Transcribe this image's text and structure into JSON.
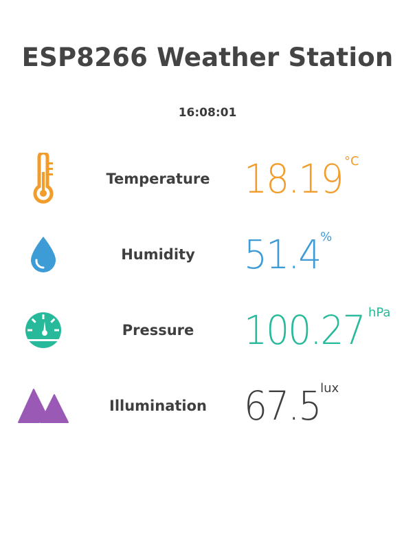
{
  "header": {
    "title": "ESP8266 Weather Station",
    "time": "16:08:01"
  },
  "readings": [
    {
      "label": "Temperature",
      "value": "18.19",
      "unit": "°C",
      "icon": "thermometer-icon",
      "color": "#f29c2b"
    },
    {
      "label": "Humidity",
      "value": "51.4",
      "unit": "%",
      "icon": "water-drop-icon",
      "color": "#3d9bd6"
    },
    {
      "label": "Pressure",
      "value": "100.27",
      "unit": "hPa",
      "icon": "gauge-icon",
      "color": "#26b99a"
    },
    {
      "label": "Illumination",
      "value": "67.5",
      "unit": "lux",
      "icon": "mountains-icon",
      "color": "#9b59b6"
    }
  ],
  "colors": {
    "illumination_value": "#3f3f3f"
  }
}
